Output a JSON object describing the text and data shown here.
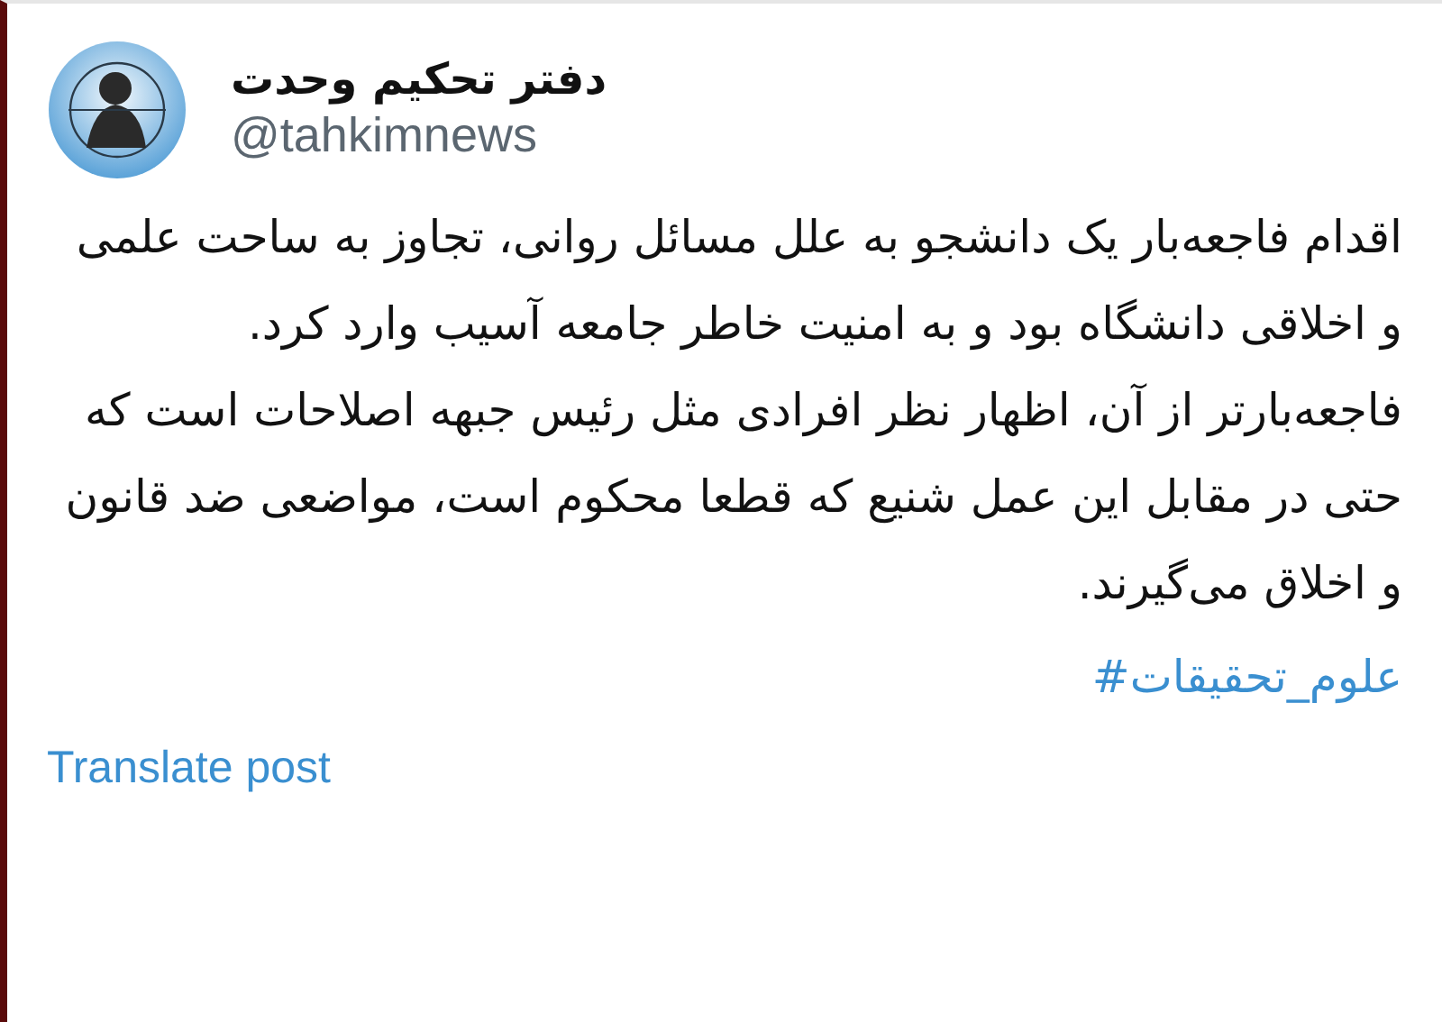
{
  "author": {
    "name": "دفتر تحکیم وحدت",
    "handle": "@tahkimnews"
  },
  "post": {
    "paragraphs": [
      "اقدام فاجعه‌بار یک دانشجو به علل مسائل روانی، تجاوز به ساحت علمی و اخلاقی دانشگاه بود و به امنیت خاطر جامعه آسیب وارد کرد.",
      "فاجعه‌بارتر از آن، اظهار نظر افرادی مثل رئیس جبهه اصلاحات است که حتی در مقابل این عمل شنیع که قطعا محکوم است، مواضعی ضد قانون و اخلاق می‌گیرند."
    ],
    "hashtag": "علوم_تحقیقات#"
  },
  "translate_link": "Translate post"
}
